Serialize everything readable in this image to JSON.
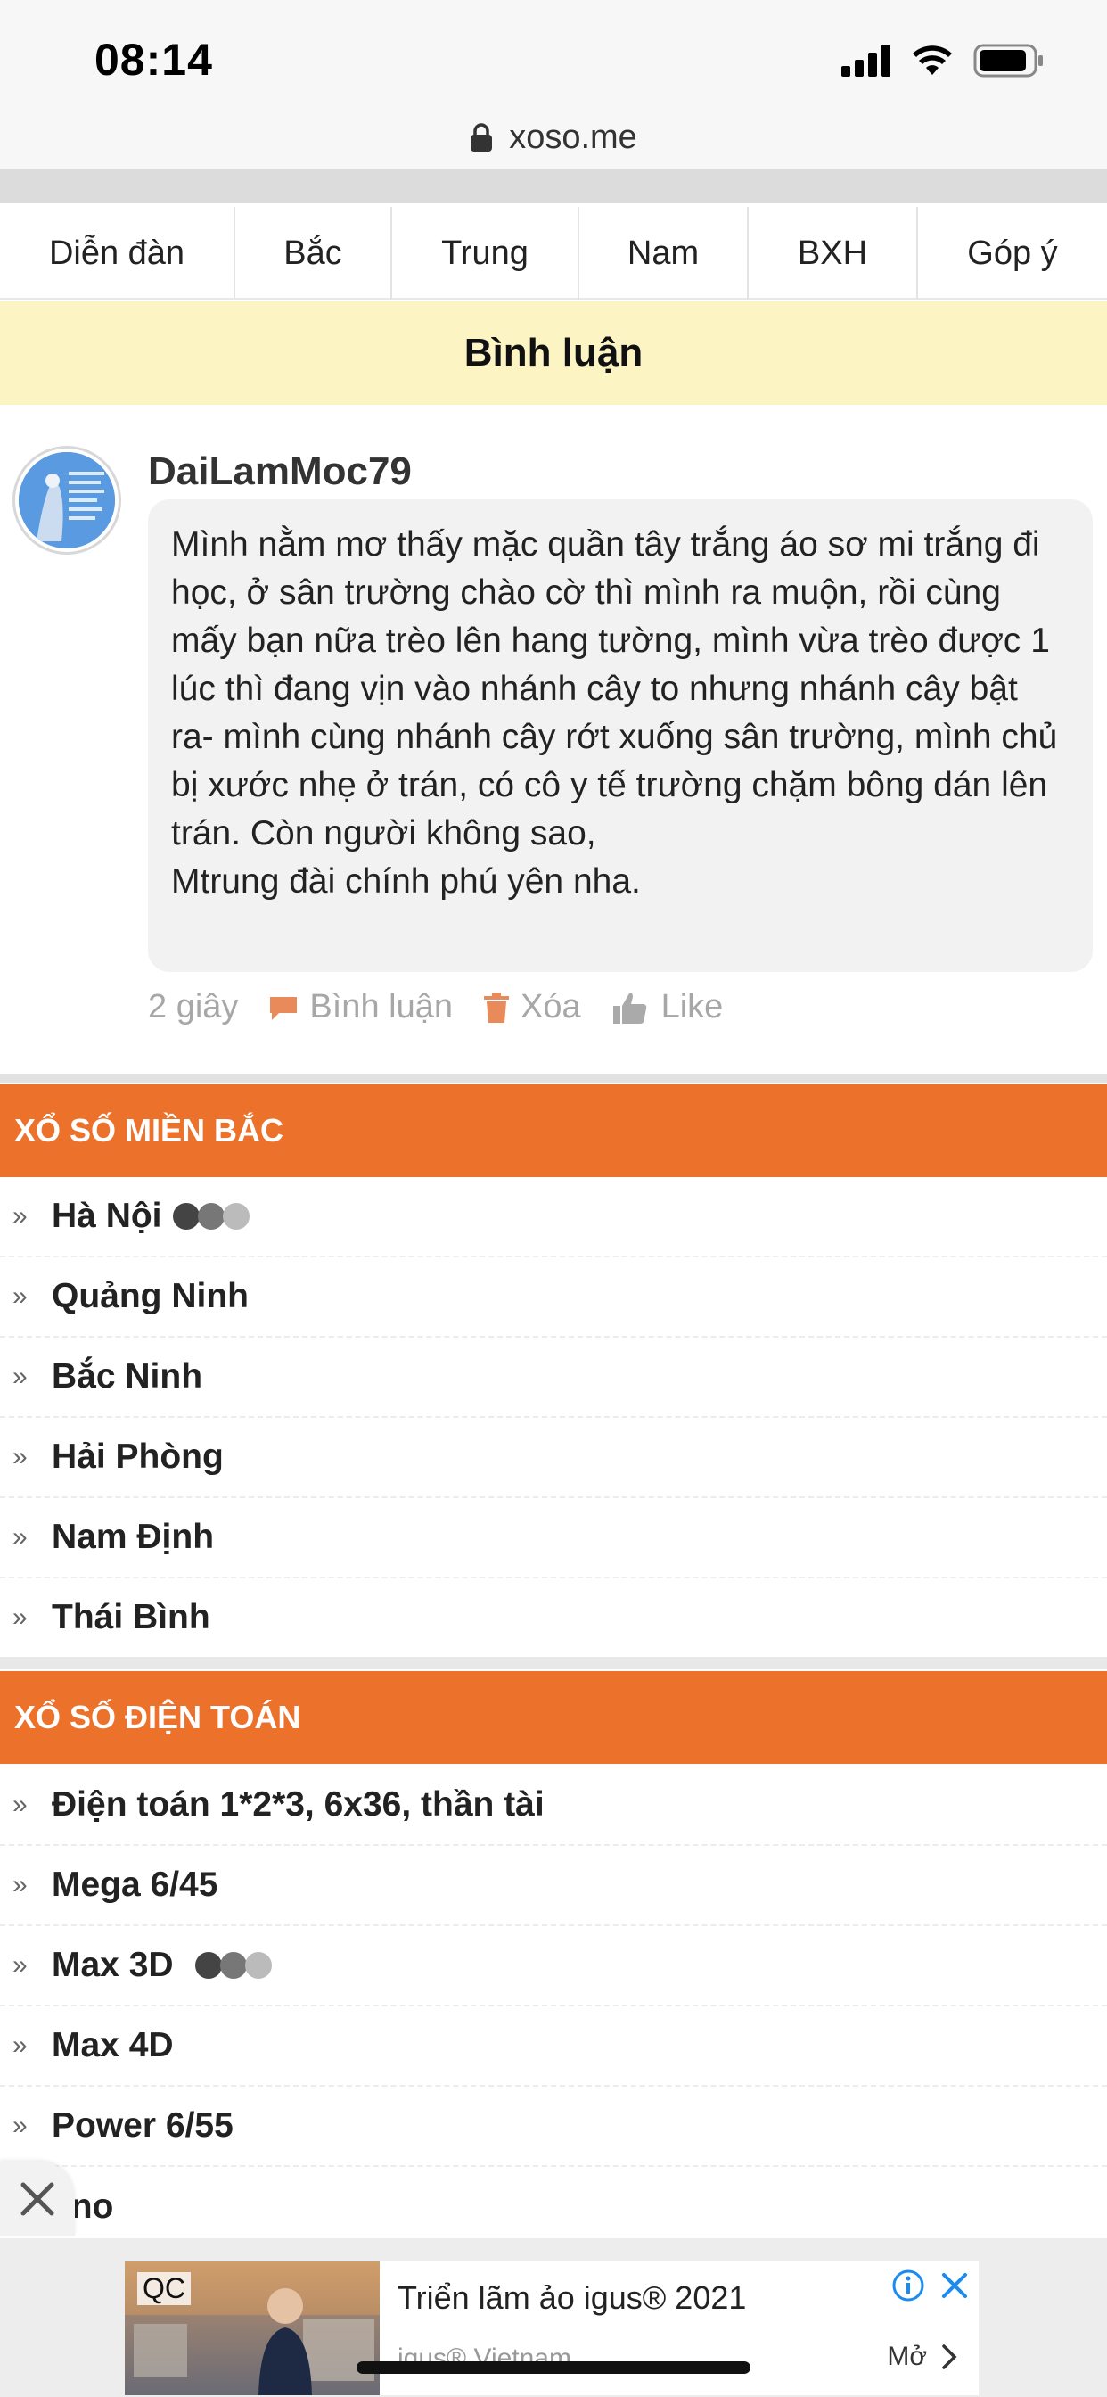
{
  "status_bar": {
    "time": "08:14"
  },
  "browser": {
    "url": "xoso.me"
  },
  "nav": {
    "tabs": [
      "Diễn đàn",
      "Bắc",
      "Trung",
      "Nam",
      "BXH",
      "Góp ý"
    ]
  },
  "page": {
    "section_title": "Bình luận"
  },
  "comment": {
    "username": "DaiLamMoc79",
    "text": "Mình nằm mơ thấy mặc quần tây trắng áo sơ mi trắng đi học, ở sân trường chào cờ thì mình ra muộn, rồi cùng mấy bạn nữa trèo lên hang tường, mình vừa trèo được 1 lúc thì đang vịn vào nhánh cây to nhưng nhánh cây bật ra- mình cùng nhánh cây rớt xuống sân trường, mình chủ bị xước nhẹ ở trán, có cô y tế trường chặm bông dán lên trán. Còn người không sao,\nMtrung đài chính phú yên nha.",
    "time": "2 giây",
    "reply_label": "Bình luận",
    "delete_label": "Xóa",
    "like_label": "Like"
  },
  "mien_bac": {
    "title": "XỔ SỐ MIỀN BẮC",
    "items": [
      "Hà Nội",
      "Quảng Ninh",
      "Bắc Ninh",
      "Hải Phòng",
      "Nam Định",
      "Thái Bình"
    ]
  },
  "dien_toan": {
    "title": "XỔ SỐ ĐIỆN TOÁN",
    "items": [
      "Điện toán 1*2*3, 6x36, thần tài",
      "Mega 6/45",
      "Max 3D",
      "Max 4D",
      "Power 6/55",
      "eno"
    ]
  },
  "ad": {
    "qc": "QC",
    "title": "Triển lãm ảo igus® 2021",
    "sub": "igus® Vietnam",
    "open": "Mở"
  },
  "colors": {
    "accent": "#ec722c",
    "section_bg": "#fdf4c4"
  }
}
